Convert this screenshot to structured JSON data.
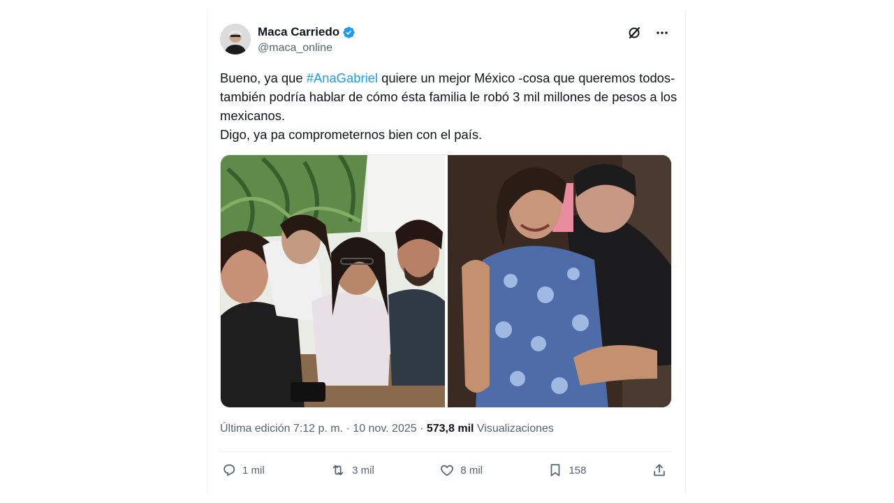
{
  "author": {
    "display_name": "Maca Carriedo",
    "handle": "@maca_online",
    "verified": true,
    "verified_color": "#1d9bf0"
  },
  "header_icons": [
    "grok-icon",
    "more-icon"
  ],
  "tweet": {
    "line1_before": "Bueno, ya que ",
    "hashtag": "#AnaGabriel",
    "line1_after": " quiere un mejor México -cosa que queremos todos- también podría hablar de cómo ésta familia le robó 3 mil millones de pesos a los mexicanos.",
    "line2": "Digo, ya pa comprometernos bien con el país."
  },
  "media": [
    {
      "alt": "group-photo"
    },
    {
      "alt": "two-women-photo"
    }
  ],
  "meta": {
    "edited": "Última edición 7:12 p. m. · 10 nov. 2025 · ",
    "views_count": "573,8 mil",
    "views_label": " Visualizaciones"
  },
  "actions": {
    "reply": "1 mil",
    "retweet": "3 mil",
    "like": "8 mil",
    "bookmark": "158"
  },
  "colors": {
    "accent": "#1d9bf0",
    "secondary_text": "#536471",
    "primary_text": "#0f1419"
  }
}
